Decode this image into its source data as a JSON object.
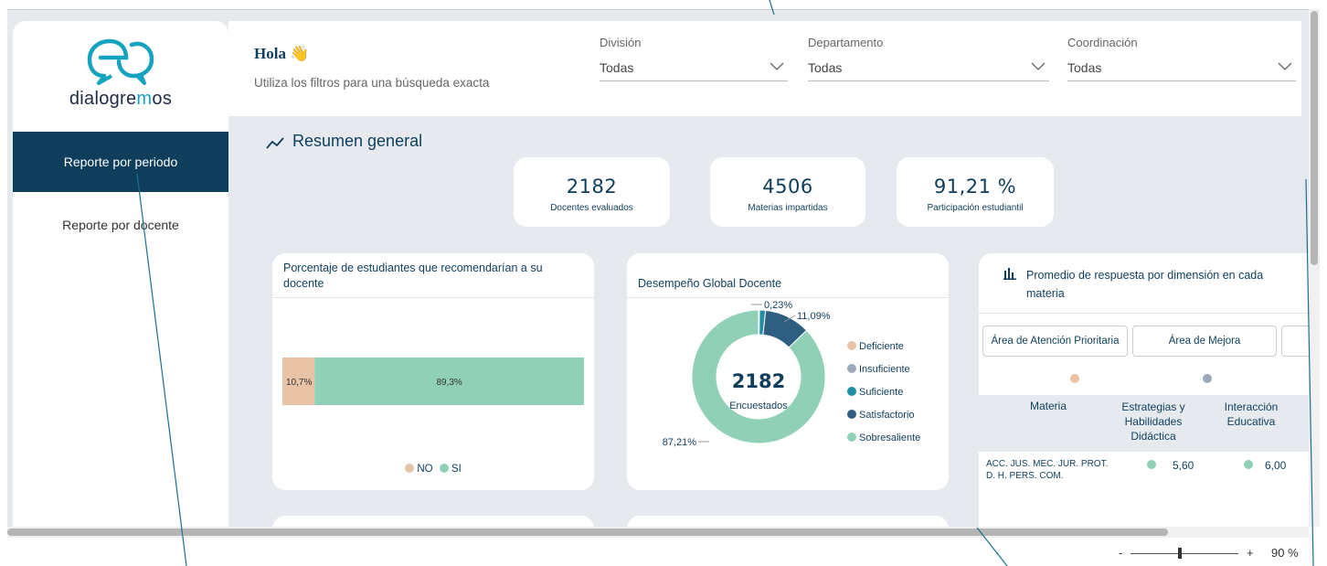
{
  "brand": {
    "logo_text_main": "dialogre",
    "logo_text_accent": "m",
    "logo_text_end": "os"
  },
  "sidebar": {
    "items": [
      {
        "label": "Reporte por periodo",
        "active": true
      },
      {
        "label": "Reporte por docente",
        "active": false
      }
    ]
  },
  "header": {
    "greeting": "Hola 👋",
    "subtitle": "Utiliza los filtros para una búsqueda exacta",
    "filters": [
      {
        "label": "División",
        "value": "Todas"
      },
      {
        "label": "Departamento",
        "value": "Todas"
      },
      {
        "label": "Coordinación",
        "value": "Todas"
      }
    ]
  },
  "section": {
    "title": "Resumen general"
  },
  "kpis": [
    {
      "value": "2182",
      "label": "Docentes evaluados"
    },
    {
      "value": "4506",
      "label": "Materias impartidas"
    },
    {
      "value": "91,21 %",
      "label": "Participación estudiantil"
    }
  ],
  "recommend_card": {
    "title": "Porcentaje de estudiantes que recomendarían a su docente",
    "legend": [
      "NO",
      "SI"
    ]
  },
  "global_card": {
    "title": "Desempeño Global Docente",
    "center_value": "2182",
    "center_label": "Encuestados",
    "legend": [
      "Deficiente",
      "Insuficiente",
      "Suficiente",
      "Satisfactorio",
      "Sobresaliente"
    ]
  },
  "dimension_card": {
    "title": "Promedio de respuesta por dimensión en cada materia",
    "filters": [
      "Área de Atención Prioritaria",
      "Área de Mejora"
    ],
    "columns": [
      "Materia",
      "Estrategias y Habilidades Didáctica",
      "Interacción Educativa"
    ],
    "rows": [
      {
        "materia": "ACC. JUS. MEC. JUR. PROT. D. H. PERS. COM.",
        "v1": "5,60",
        "v2": "6,00"
      }
    ]
  },
  "status": {
    "zoom_minus": "-",
    "zoom_plus": "+",
    "zoom_level": "90 %"
  },
  "colors": {
    "primary": "#0e3e5c",
    "no": "#e8c3a6",
    "si": "#8fd0b7",
    "deficiente": "#e8c3a6",
    "insuficiente": "#9aa9b8",
    "suficiente": "#1e8fa5",
    "satisfactorio": "#2f5f80",
    "sobresaliente": "#8fd0b7"
  },
  "chart_data": [
    {
      "type": "bar",
      "title": "Porcentaje de estudiantes que recomendarían a su docente",
      "orientation": "horizontal-stacked",
      "categories": [
        "NO",
        "SI"
      ],
      "values": [
        10.7,
        89.3
      ],
      "value_labels": [
        "10,7%",
        "89,3%"
      ],
      "legend": "bottom"
    },
    {
      "type": "pie",
      "title": "Desempeño Global Docente",
      "donut": true,
      "categories": [
        "Deficiente",
        "Insuficiente",
        "Suficiente",
        "Satisfactorio",
        "Sobresaliente"
      ],
      "values": [
        0.0,
        0.23,
        1.47,
        11.09,
        87.21
      ],
      "data_labels": {
        "Suficiente": "0,23%",
        "Satisfactorio": "11,09%",
        "Sobresaliente": "87,21%"
      },
      "legend": "right"
    }
  ]
}
